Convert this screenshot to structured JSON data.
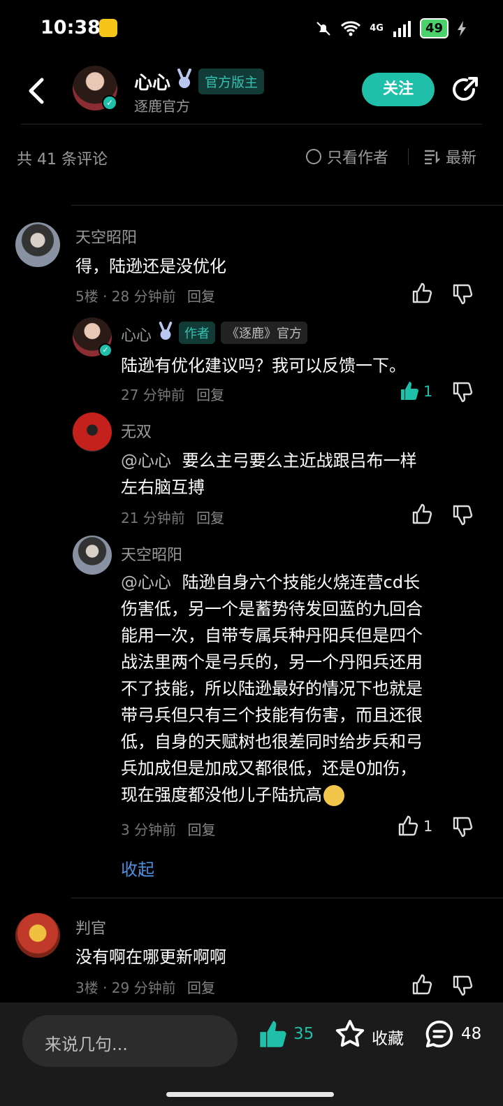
{
  "status": {
    "time": "10:38",
    "signal": "4G",
    "battery": "49"
  },
  "header": {
    "name": "心心",
    "badge": "官方版主",
    "subtitle": "逐鹿官方",
    "follow_label": "关注"
  },
  "toolbar": {
    "count_label": "共 41 条评论",
    "author_only_label": "只看作者",
    "sort_label": "最新"
  },
  "comments": [
    {
      "user": "天空昭阳",
      "text": "得，陆逊还是没优化",
      "meta": "5楼 · 28 分钟前",
      "reply": "回复",
      "replies": [
        {
          "user": "心心",
          "tag_author": "作者",
          "tag_official": "《逐鹿》官方",
          "text": "陆逊有优化建议吗？我可以反馈一下。",
          "meta": "27 分钟前",
          "reply": "回复",
          "likes": "1"
        },
        {
          "user": "无双",
          "mention": "@心心",
          "text_line1": "要么主弓要么主近战跟吕布一样",
          "text_line2": "左右脑互搏",
          "meta": "21 分钟前",
          "reply": "回复"
        },
        {
          "user": "天空昭阳",
          "mention": "@心心",
          "lines": [
            "陆逊自身六个技能火烧连营cd长",
            "伤害低，另一个是蓄势待发回蓝的九回合",
            "能用一次，自带专属兵种丹阳兵但是四个",
            "战法里两个是弓兵的，另一个丹阳兵还用",
            "不了技能，所以陆逊最好的情况下也就是",
            "带弓兵但只有三个技能有伤害，而且还很",
            "低，自身的天赋树也很差同时给步兵和弓",
            "兵加成但是加成又都很低，还是0加伤，",
            "现在强度都没他儿子陆抗高"
          ],
          "meta": "3 分钟前",
          "reply": "回复",
          "likes": "1"
        }
      ],
      "collapse_label": "收起"
    },
    {
      "user": "判官",
      "text": "没有啊在哪更新啊啊",
      "meta": "3楼 · 29 分钟前",
      "reply": "回复"
    }
  ],
  "bottom_bar": {
    "placeholder": "来说几句...",
    "likes": "35",
    "favorite_label": "收藏",
    "comments": "48"
  },
  "colors": {
    "accent": "#1fbfaa",
    "background": "#000000",
    "bottom_bar": "#1b1b1b"
  }
}
